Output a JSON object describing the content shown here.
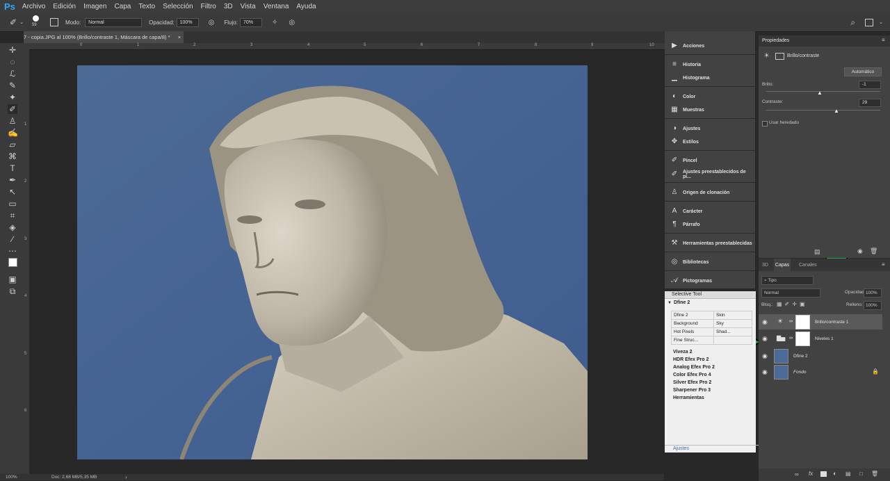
{
  "app": {
    "logo": "Ps"
  },
  "menu": [
    "Archivo",
    "Edición",
    "Imagen",
    "Capa",
    "Texto",
    "Selección",
    "Filtro",
    "3D",
    "Vista",
    "Ventana",
    "Ayuda"
  ],
  "options": {
    "brush_size": "59",
    "mode_label": "Modo:",
    "mode_value": "Normal",
    "opacity_label": "Opacidad:",
    "opacity_value": "100%",
    "flow_label": "Flujo:",
    "flow_value": "70%"
  },
  "document": {
    "tab_title": "7 - copia.JPG al 100% (Brillo/contraste 1, Máscara de capa/8) *",
    "ruler_top": [
      "0",
      "1",
      "2",
      "3",
      "4",
      "5",
      "6",
      "7",
      "8",
      "9",
      "10"
    ],
    "ruler_left": [
      "1",
      "2",
      "3",
      "4",
      "5",
      "6"
    ]
  },
  "status": {
    "zoom": "100%",
    "doc": "Doc: 2,68 MB/5,35 MB"
  },
  "dock": [
    {
      "label": "Acciones",
      "icon": "play-icon"
    },
    {
      "label": "Historia",
      "icon": "history-icon"
    },
    {
      "label": "Histograma",
      "icon": "histogram-icon"
    },
    {
      "label": "Color",
      "icon": "palette-icon"
    },
    {
      "label": "Muestras",
      "icon": "swatches-icon"
    },
    {
      "label": "Ajustes",
      "icon": "adjustments-icon"
    },
    {
      "label": "Estilos",
      "icon": "styles-icon"
    },
    {
      "label": "Pincel",
      "icon": "brush-icon"
    },
    {
      "label": "Ajustes preestablecidos de pi...",
      "icon": "brush-presets-icon"
    },
    {
      "label": "Origen de clonación",
      "icon": "clone-source-icon"
    },
    {
      "label": "Carácter",
      "icon": "character-icon"
    },
    {
      "label": "Párrafo",
      "icon": "paragraph-icon"
    },
    {
      "label": "Herramientas preestablecidas",
      "icon": "tool-presets-icon"
    },
    {
      "label": "Bibliotecas",
      "icon": "libraries-icon"
    },
    {
      "label": "Pictogramas",
      "icon": "glyphs-icon"
    }
  ],
  "selective_tool": {
    "title": "Selective Tool",
    "dfine_header": "Dfine 2",
    "rows": [
      [
        "Dfine 2",
        "Skin"
      ],
      [
        "Background",
        "Sky"
      ],
      [
        "Hot Pixels",
        "Shad..."
      ],
      [
        "Fine Struc...",
        ""
      ]
    ],
    "sections": [
      "Viveza 2",
      "HDR Efex Pro 2",
      "Analog Efex Pro 2",
      "Color Efex Pro 4",
      "Silver Efex Pro 2",
      "Sharpener Pro 3",
      "Herramientas"
    ],
    "footer": "Ajustes"
  },
  "properties": {
    "title": "Propiedades",
    "layer_name": "Brillo/contraste",
    "auto_button": "Automático",
    "brightness_label": "Brillo:",
    "brightness_value": "-1",
    "contrast_label": "Contraste:",
    "contrast_value": "29",
    "legacy_label": "Usar heredado"
  },
  "layers": {
    "tabs": [
      "3D",
      "Capas",
      "Canales"
    ],
    "filter": "Tipo",
    "blend": "Normal",
    "opacity_label": "Opacidad:",
    "opacity": "100%",
    "lock_label": "Bloq.:",
    "fill_label": "Relleno:",
    "fill": "100%",
    "items": [
      "Brillo/contraste 1",
      "Niveles 1",
      "Dfine 2",
      "Fondo"
    ]
  },
  "annotations": {
    "arrow_1": "1",
    "arrow_2": "2",
    "arrow_3": "3",
    "arrow_color": "#1fa83e"
  }
}
